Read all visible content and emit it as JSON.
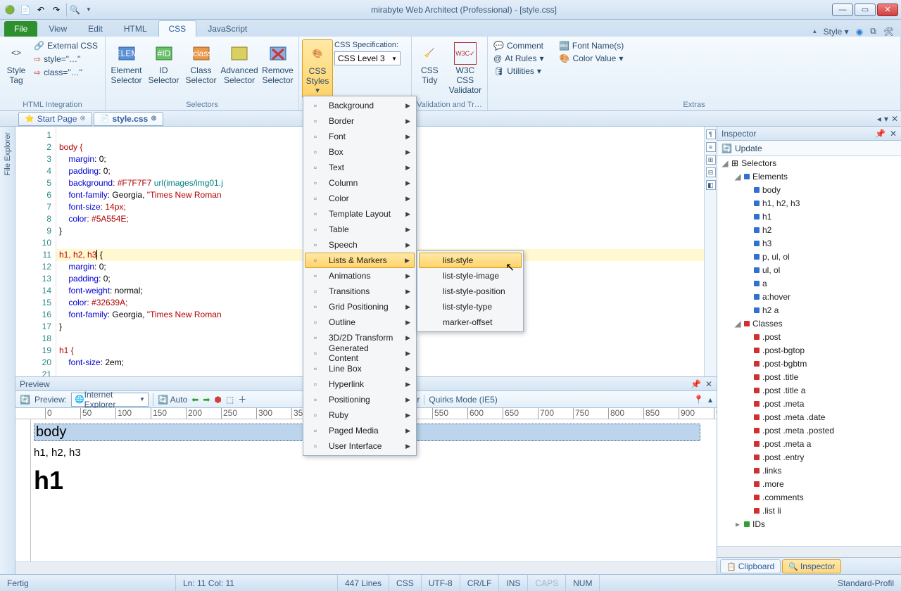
{
  "window": {
    "title": "mirabyte Web Architect (Professional) - [style.css]"
  },
  "tabs": {
    "file": "File",
    "view": "View",
    "edit": "Edit",
    "html": "HTML",
    "css": "CSS",
    "js": "JavaScript",
    "style": "Style"
  },
  "ribbon": {
    "g1": {
      "label": "HTML Integration",
      "styletag": "Style\nTag",
      "ext": "External CSS",
      "st": "style=\"…\"",
      "cl": "class=\"…\""
    },
    "g2": {
      "label": "Selectors",
      "elem": "Element\nSelector",
      "id": "ID\nSelector",
      "class": "Class\nSelector",
      "adv": "Advanced\nSelector",
      "rem": "Remove\nSelector"
    },
    "g3": {
      "cssstyles": "CSS\nStyles",
      "spec": "CSS Specification:",
      "level": "CSS Level 3"
    },
    "g4": {
      "label": "Validation and Tr…",
      "tidy": "CSS\nTidy",
      "w3c": "W3C CSS\nValidator"
    },
    "g5": {
      "label": "Extras",
      "comment": "Comment",
      "atrules": "At Rules",
      "utilities": "Utilities",
      "fontnames": "Font Name(s)",
      "colorvalue": "Color Value"
    }
  },
  "docs": {
    "start": "Start Page",
    "css": "style.css"
  },
  "sidebar": {
    "fileexplorer": "File Explorer"
  },
  "code": {
    "lines": [
      "1",
      "2",
      "3",
      "4",
      "5",
      "6",
      "7",
      "8",
      "9",
      "10",
      "11",
      "12",
      "13",
      "14",
      "15",
      "16",
      "17",
      "18",
      "19",
      "20",
      "21"
    ],
    "l2": "body {",
    "l3m": "margin",
    "l3v": ": 0;",
    "l4m": "padding",
    "l4v": ": 0;",
    "l5m": "background",
    "l5v": ": #F7F7F7 ",
    "l5u": "url(images/img01.j",
    "l6m": "font-family",
    "l6v": ": Georgia, ",
    "l6s": "\"Times New Roman",
    "l7m": "font-size",
    "l7v": ": 14px;",
    "l8m": "color",
    "l8v": ": #5A554E;",
    "l9": "}",
    "l11": "h1, h2, h3",
    "l11b": " {",
    "l12m": "margin",
    "l12v": ": 0;",
    "l13m": "padding",
    "l13v": ": 0;",
    "l14m": "font-weight",
    "l14v": ": normal;",
    "l15m": "color",
    "l15v": ": #32639A;",
    "l16m": "font-family",
    "l16v": ": Georgia, ",
    "l16s": "\"Times New Roman",
    "l17": "}",
    "l19": "h1 {",
    "l20m": "font-size",
    "l20v": ": 2em;"
  },
  "menu": {
    "items": [
      "Background",
      "Border",
      "Font",
      "Box",
      "Text",
      "Column",
      "Color",
      "Template Layout",
      "Table",
      "Speech",
      "Lists & Markers",
      "Animations",
      "Transitions",
      "Grid Positioning",
      "Outline",
      "3D/2D Transform",
      "Generated Content",
      "Line Box",
      "Hyperlink",
      "Positioning",
      "Ruby",
      "Paged Media",
      "User Interface"
    ],
    "sub": [
      "list-style",
      "list-style-image",
      "list-style-position",
      "list-style-type",
      "marker-offset"
    ]
  },
  "preview": {
    "title": "Preview",
    "label": "Preview:",
    "browser": "Internet Explorer",
    "auto": "Auto",
    "ws": "Web Server",
    "mode": "Quirks Mode (IE5)",
    "body": "body",
    "h123": "h1, h2, h3",
    "h1": "h1"
  },
  "inspector": {
    "title": "Inspector",
    "update": "Update",
    "selectors": "Selectors",
    "elements": "Elements",
    "classes": "Classes",
    "ids": "IDs",
    "el": [
      "body",
      "h1, h2, h3",
      "h1",
      "h2",
      "h3",
      "p, ul, ol",
      "ul, ol",
      "a",
      "a:hover",
      "h2 a"
    ],
    "cl": [
      ".post",
      ".post-bgtop",
      ".post-bgbtm",
      ".post .title",
      ".post .title a",
      ".post .meta",
      ".post .meta .date",
      ".post .meta .posted",
      ".post .meta a",
      ".post .entry",
      ".links",
      ".more",
      ".comments",
      ".list li"
    ],
    "tabs": {
      "clipboard": "Clipboard",
      "inspector": "Inspector"
    }
  },
  "status": {
    "ready": "Fertig",
    "pos": "Ln: 11  Col: 11",
    "lines": "447 Lines",
    "lang": "CSS",
    "enc": "UTF-8",
    "crlf": "CR/LF",
    "ins": "INS",
    "caps": "CAPS",
    "num": "NUM",
    "profile": "Standard-Profil"
  }
}
